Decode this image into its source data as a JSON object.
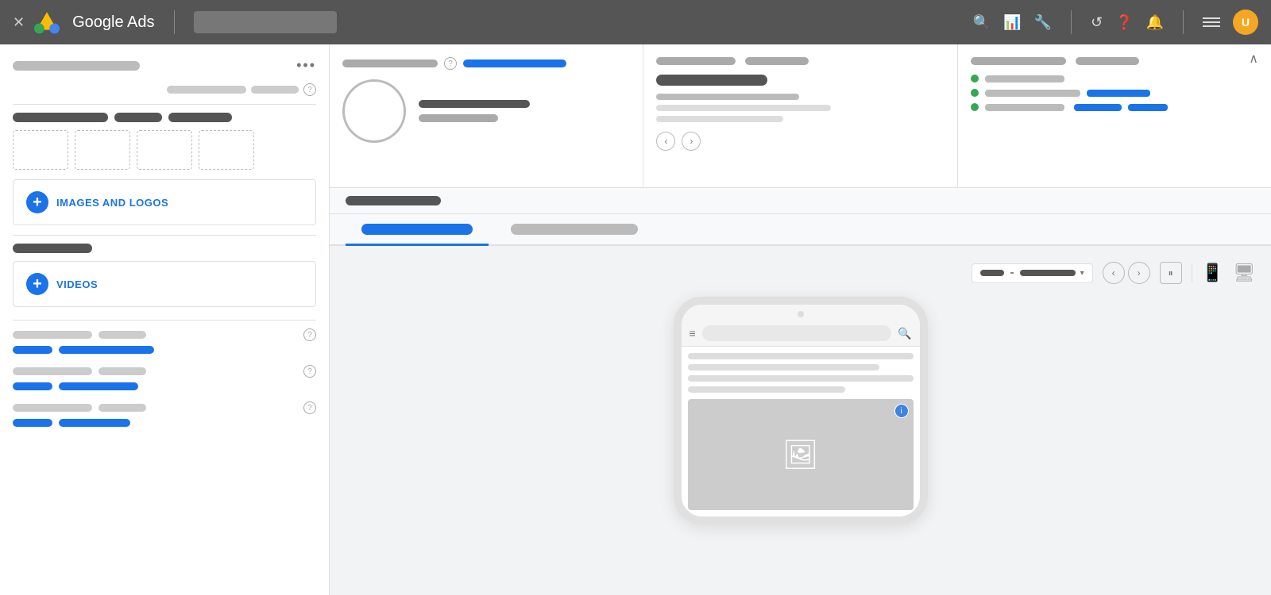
{
  "topbar": {
    "title": "Google Ads",
    "close_label": "×",
    "avatar_initial": "U"
  },
  "sidebar": {
    "title_bar1_width": 160,
    "title_bar2_width": 90,
    "three_dots": "•••",
    "images_section": {
      "label": "IMAGES AND LOGOS",
      "button_label": "IMAGES AND LOGOS"
    },
    "videos_section": {
      "label": "VIDEOS",
      "button_label": "VIDEOS"
    },
    "field_groups": [
      {
        "help": true
      },
      {
        "help": true
      },
      {
        "help": true
      }
    ]
  },
  "main": {
    "panel1": {
      "title_bar_width": 120,
      "blue_bar_width": 130
    },
    "panel2": {
      "title": ""
    },
    "panel3": {
      "title_bar_width": 120,
      "items": 3
    },
    "preview": {
      "section_title": "",
      "tabs": [
        {
          "label": "",
          "active": true
        },
        {
          "label": "",
          "active": false
        }
      ],
      "controls": {
        "dropdown_label": ""
      }
    }
  },
  "icons": {
    "search": "🔍",
    "bar_chart": "📊",
    "wrench": "🔧",
    "refresh": "↺",
    "help": "?",
    "bell": "🔔",
    "close": "✕",
    "chevron_up": "∧",
    "chevron_down": "⌄",
    "nav_prev": "‹",
    "nav_next": "›",
    "pause": "⏸",
    "mobile": "📱",
    "desktop": "🖥",
    "image": "🖼",
    "menu": "≡",
    "magnify": "🔍",
    "info": "i",
    "plus": "+"
  }
}
